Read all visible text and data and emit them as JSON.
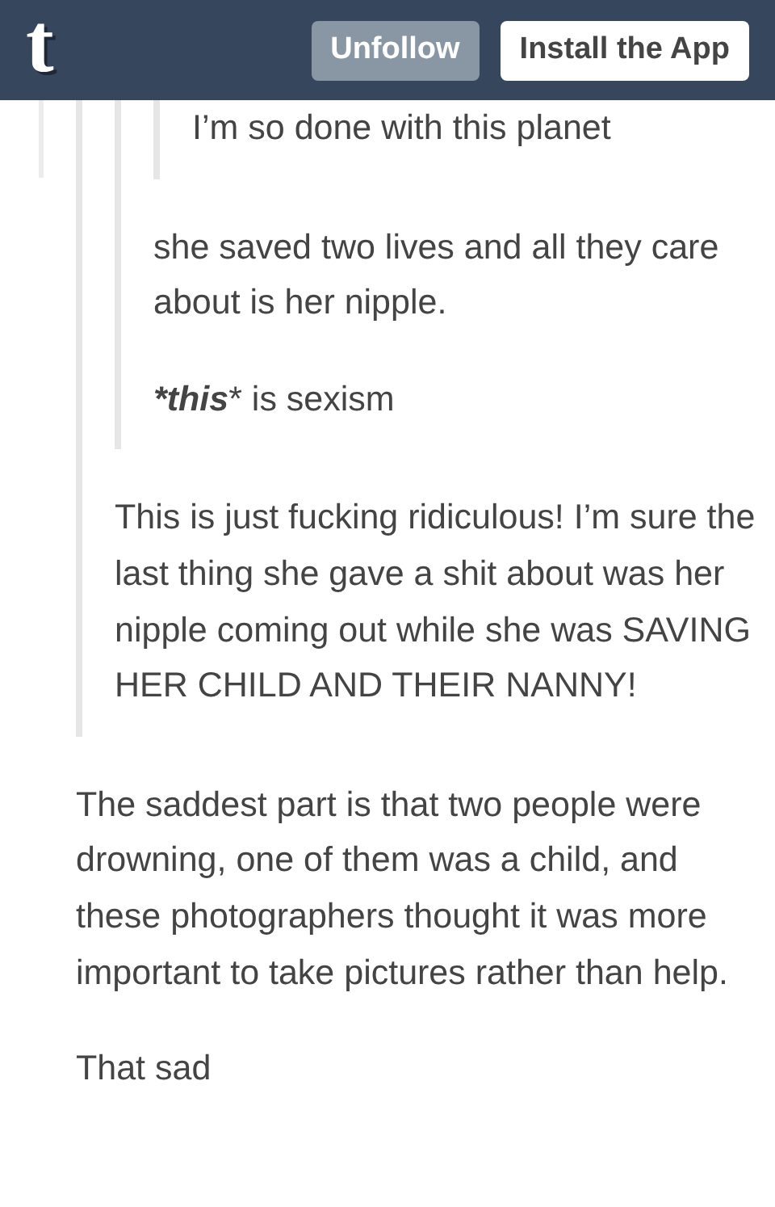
{
  "header": {
    "logo": "t",
    "buttons": [
      {
        "label": "Unfollow",
        "kind": "secondary"
      },
      {
        "label": "Install the App",
        "kind": "primary"
      }
    ]
  },
  "thread": [
    {
      "kind": "quote",
      "children": [
        {
          "kind": "quote",
          "children": [
            {
              "kind": "quote",
              "children": [
                {
                  "kind": "text",
                  "text": "I’m so done with this planet"
                }
              ]
            },
            {
              "kind": "text",
              "text": "she saved two lives and all they care about is her nipple."
            },
            {
              "kind": "text",
              "text": "***this*** is sexism"
            }
          ]
        },
        {
          "kind": "text",
          "text": "This is just fucking ridiculous! I’m sure the last thing she gave a shit about was her nipple coming out while she was SAVING HER CHILD AND THEIR NANNY!"
        }
      ]
    },
    {
      "kind": "text",
      "text": "The saddest part is that two people were drowning, one of them was a child, and these photographers thought it was more important to take pictures rather than help."
    },
    {
      "kind": "text",
      "text": "That sad"
    }
  ]
}
